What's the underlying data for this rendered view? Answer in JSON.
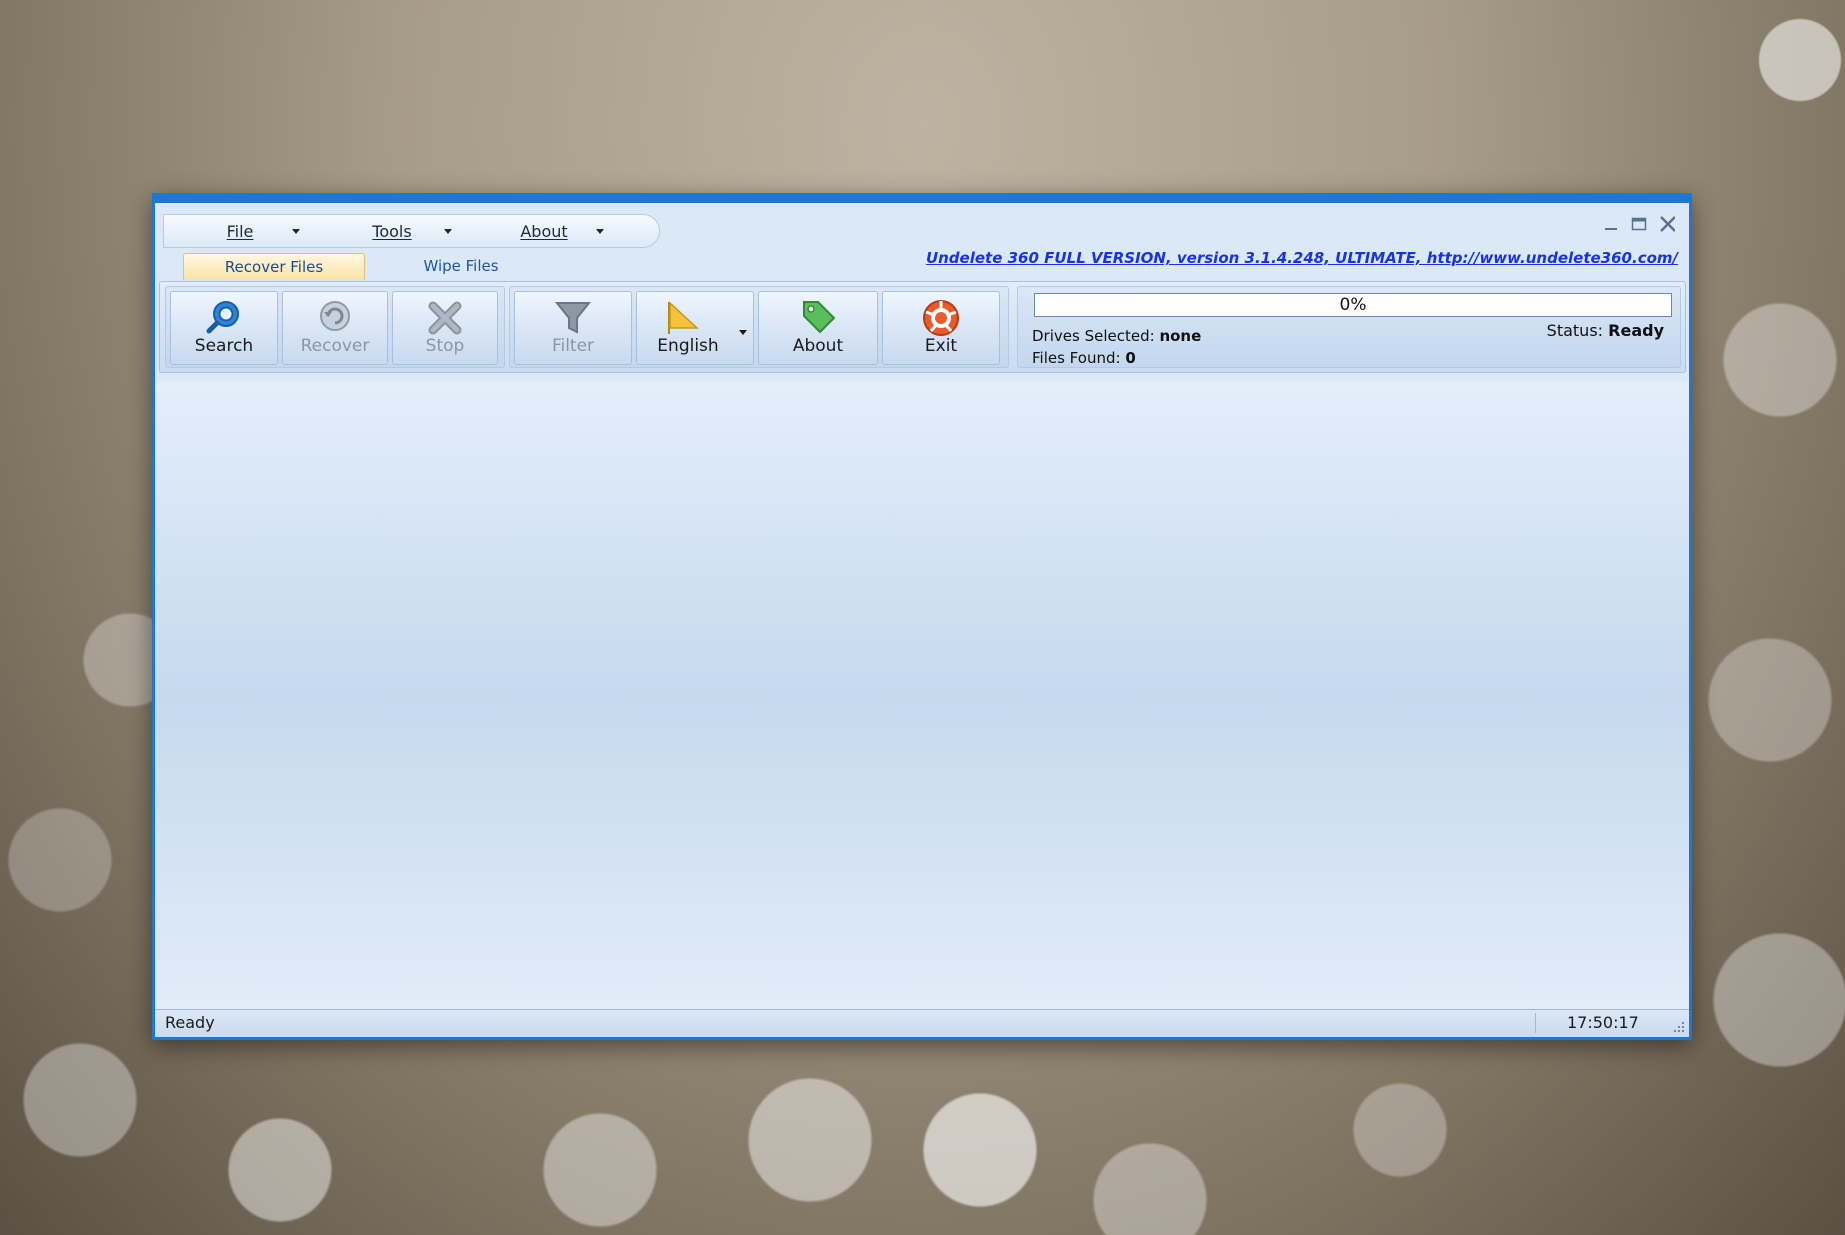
{
  "menubar": {
    "items": [
      {
        "label": "File"
      },
      {
        "label": "Tools"
      },
      {
        "label": "About"
      }
    ]
  },
  "tabs": [
    {
      "label": "Recover Files",
      "active": true
    },
    {
      "label": "Wipe Files",
      "active": false
    }
  ],
  "version_text": "Undelete 360 FULL VERSION, version 3.1.4.248, ULTIMATE, http://www.undelete360.com/",
  "toolbar": {
    "search": "Search",
    "recover": "Recover",
    "stop": "Stop",
    "filter": "Filter",
    "language": "English",
    "about": "About",
    "exit": "Exit"
  },
  "info": {
    "progress_text": "0%",
    "progress_value": 0,
    "drives_label": "Drives Selected:",
    "drives_value": "none",
    "files_label": "Files Found:",
    "files_value": "0",
    "status_label": "Status:",
    "status_value": "Ready"
  },
  "statusbar": {
    "left": "Ready",
    "time": "17:50:17"
  },
  "colors": {
    "window_border": "#1e78d2",
    "link": "#1a33e0",
    "active_tab": "#fbe3a9"
  }
}
